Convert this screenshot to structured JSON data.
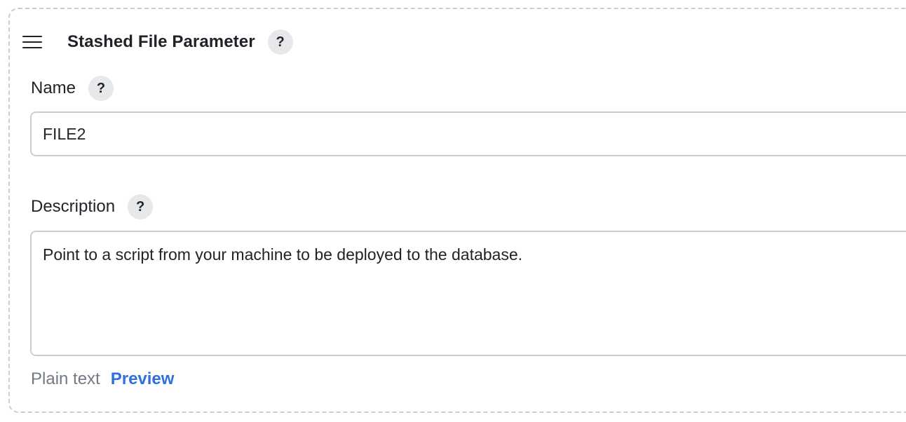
{
  "section": {
    "title": "Stashed File Parameter",
    "help_symbol": "?"
  },
  "name_field": {
    "label": "Name",
    "help_symbol": "?",
    "value": "FILE2"
  },
  "description_field": {
    "label": "Description",
    "help_symbol": "?",
    "value": "Point to a script from your machine to be deployed to the database."
  },
  "footer": {
    "plain_text_label": "Plain text",
    "preview_label": "Preview"
  },
  "icons": {
    "drag_handle": "hamburger-icon",
    "help": "question-mark-icon"
  },
  "colors": {
    "link": "#2f6fe0",
    "border": "#c9ced6",
    "help_bg": "#e7e8ea"
  }
}
